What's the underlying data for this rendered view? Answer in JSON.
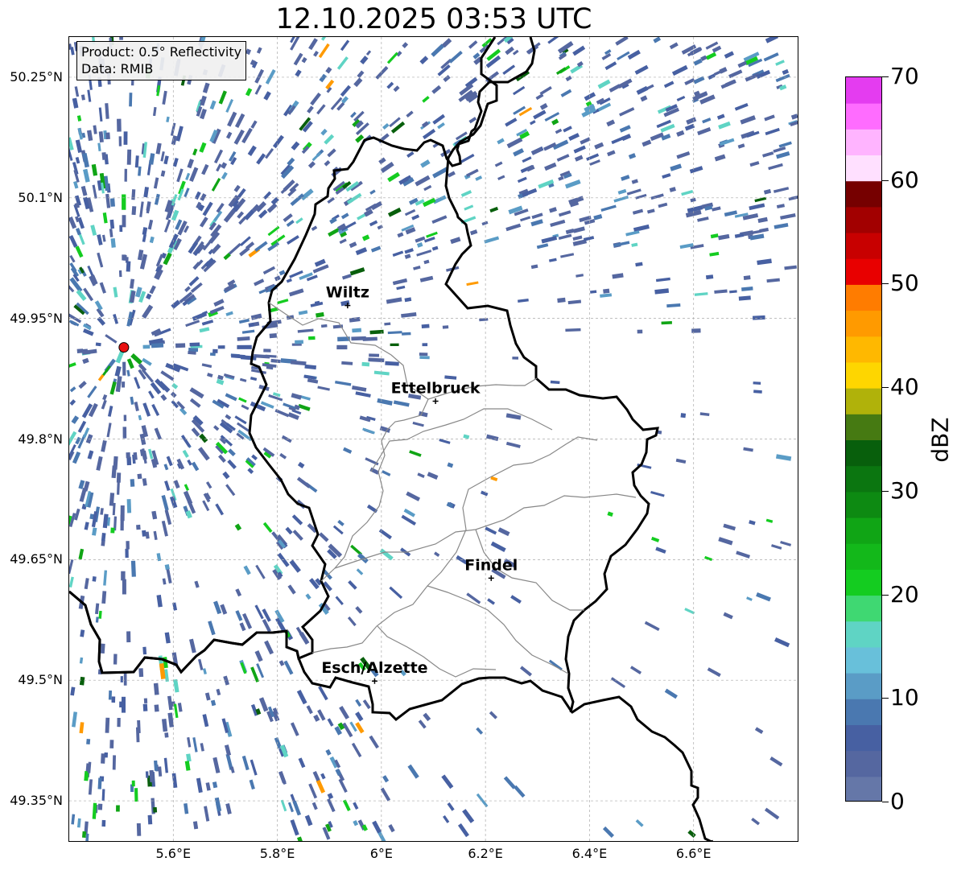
{
  "title": "12.10.2025 03:53 UTC",
  "info_box": {
    "line1": "Product: 0.5° Reflectivity",
    "line2": "Data: RMIB"
  },
  "lat_ticks": [
    {
      "value": 50.25,
      "label": "50.25°N"
    },
    {
      "value": 50.1,
      "label": "50.1°N"
    },
    {
      "value": 49.95,
      "label": "49.95°N"
    },
    {
      "value": 49.8,
      "label": "49.8°N"
    },
    {
      "value": 49.65,
      "label": "49.65°N"
    },
    {
      "value": 49.5,
      "label": "49.5°N"
    },
    {
      "value": 49.35,
      "label": "49.35°N"
    }
  ],
  "lon_ticks": [
    {
      "value": 5.6,
      "label": "5.6°E"
    },
    {
      "value": 5.8,
      "label": "5.8°E"
    },
    {
      "value": 6.0,
      "label": "6°E"
    },
    {
      "value": 6.2,
      "label": "6.2°E"
    },
    {
      "value": 6.4,
      "label": "6.4°E"
    },
    {
      "value": 6.6,
      "label": "6.6°E"
    }
  ],
  "map_extent": {
    "lon_min": 5.4,
    "lon_max": 6.8,
    "lat_min": 49.3,
    "lat_max": 50.3
  },
  "cities": [
    {
      "name": "Wiltz",
      "lon": 5.935,
      "lat": 49.966
    },
    {
      "name": "Ettelbruck",
      "lon": 6.104,
      "lat": 49.847
    },
    {
      "name": "Findel",
      "lon": 6.211,
      "lat": 49.627
    },
    {
      "name": "Esch/Alzette",
      "lon": 5.987,
      "lat": 49.499
    }
  ],
  "radar_site": {
    "lon": 5.505,
    "lat": 49.914,
    "color": "#e81010"
  },
  "colorbar": {
    "label": "dBZ",
    "min": 0,
    "max": 70,
    "ticks": [
      {
        "value": 0,
        "label": "0"
      },
      {
        "value": 10,
        "label": "10"
      },
      {
        "value": 20,
        "label": "20"
      },
      {
        "value": 30,
        "label": "30"
      },
      {
        "value": 40,
        "label": "40"
      },
      {
        "value": 50,
        "label": "50"
      },
      {
        "value": 60,
        "label": "60"
      },
      {
        "value": 70,
        "label": "70"
      }
    ],
    "colors": [
      "#6577a8",
      "#5567a0",
      "#4760a2",
      "#4a78b0",
      "#5a9cc6",
      "#68c0da",
      "#5fd4c4",
      "#3fd872",
      "#14cc20",
      "#13b81a",
      "#10a515",
      "#0d8a12",
      "#0b7610",
      "#085f0c",
      "#467a12",
      "#b0b20a",
      "#fed600",
      "#ffb800",
      "#ff9a00",
      "#ff7c00",
      "#e80000",
      "#c80000",
      "#a20000",
      "#760000",
      "#ffe0ff",
      "#ffb4ff",
      "#ff6cff",
      "#e43cf0"
    ]
  }
}
